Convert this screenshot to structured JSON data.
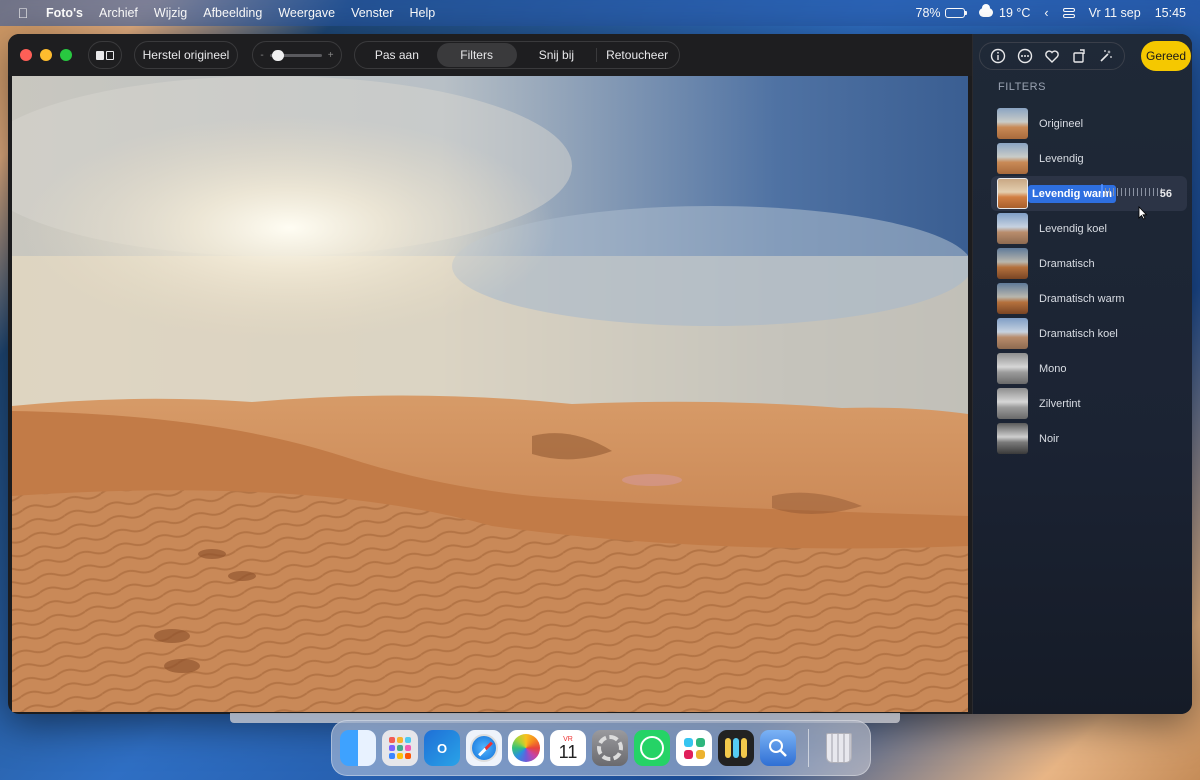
{
  "menubar": {
    "app_name": "Foto's",
    "menus": [
      "Archief",
      "Wijzig",
      "Afbeelding",
      "Weergave",
      "Venster",
      "Help"
    ],
    "battery_text": "78%",
    "battery_level": 0.78,
    "weather_text": "19 °C",
    "date_text": "Vr 11 sep",
    "time_text": "15:45"
  },
  "toolbar": {
    "revert_label": "Herstel origineel",
    "slider_minus": "-",
    "slider_plus": "+",
    "tabs": [
      {
        "label": "Pas aan",
        "active": false
      },
      {
        "label": "Filters",
        "active": true
      },
      {
        "label": "Snij bij",
        "active": false
      },
      {
        "label": "Retoucheer",
        "active": false
      }
    ]
  },
  "sidebar": {
    "tools": [
      "info-icon",
      "more-icon",
      "favorite-icon",
      "rotate-icon",
      "auto-enhance-icon"
    ],
    "done_label": "Gereed",
    "heading": "FILTERS",
    "filters": [
      {
        "label": "Origineel",
        "style": "normal"
      },
      {
        "label": "Levendig",
        "style": "normal"
      },
      {
        "label": "Levendig warm",
        "style": "warm",
        "selected": true,
        "intensity": 56
      },
      {
        "label": "Levendig koel",
        "style": "cool"
      },
      {
        "label": "Dramatisch",
        "style": "drama"
      },
      {
        "label": "Dramatisch warm",
        "style": "drama"
      },
      {
        "label": "Dramatisch koel",
        "style": "cool"
      },
      {
        "label": "Mono",
        "style": "mono"
      },
      {
        "label": "Zilvertint",
        "style": "mono"
      },
      {
        "label": "Noir",
        "style": "noir"
      }
    ]
  },
  "dock": {
    "calendar_day": "VR",
    "calendar_date": "11"
  },
  "colors": {
    "accent_done": "#f5c800",
    "selection_blue": "#2e6fe0"
  }
}
